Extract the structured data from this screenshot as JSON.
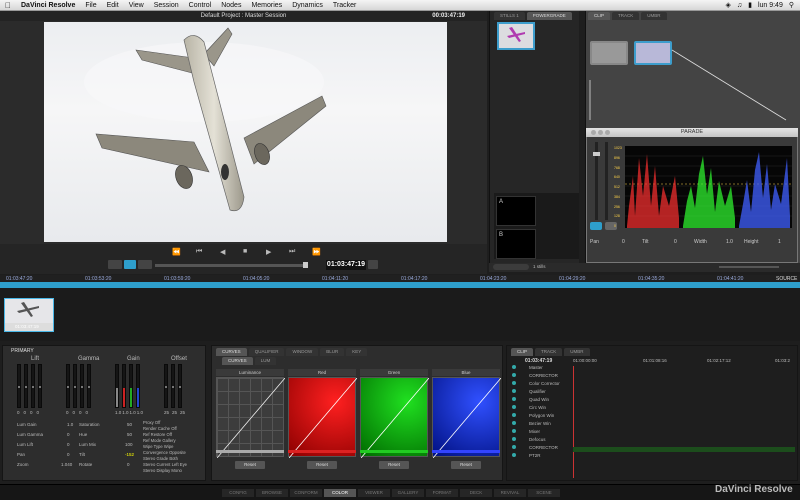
{
  "menubar": {
    "app": "DaVinci Resolve",
    "items": [
      "File",
      "Edit",
      "View",
      "Session",
      "Control",
      "Nodes",
      "Memories",
      "Dynamics",
      "Tracker"
    ],
    "clock": "lun 9:49"
  },
  "viewer": {
    "title": "Default Project : Master Session",
    "timecode_top": "00:03:47:19",
    "timecode": "01:03:47:19"
  },
  "gallery": {
    "tabs": [
      "STILLS 1",
      "POWERGRADE"
    ],
    "labels": [
      "A",
      "B"
    ],
    "status": "1 stills"
  },
  "nodes_panel": {
    "tabs": [
      "CLIP",
      "TRACK",
      "UMBR"
    ]
  },
  "parade": {
    "title": "PARADE",
    "scale": [
      "1023",
      "896",
      "768",
      "640",
      "512",
      "384",
      "256",
      "128",
      "0"
    ],
    "params": [
      {
        "label": "Pan",
        "value": "0"
      },
      {
        "label": "Tilt",
        "value": "0"
      },
      {
        "label": "Width",
        "value": "1.0"
      },
      {
        "label": "Height",
        "value": "1"
      }
    ]
  },
  "timeline": {
    "ruler": [
      "01:03:47:20",
      "01:03:53:20",
      "01:03:59:20",
      "01:04:05:20",
      "01:04:11:20",
      "01:04:17:20",
      "01:04:23:20",
      "01:04:29:20",
      "01:04:35:20",
      "01:04:41:20"
    ],
    "source_label": "SOURCE",
    "clip_label": "01:03:47:19"
  },
  "primary": {
    "title": "PRIMARY",
    "groups": [
      "Lift",
      "Gamma",
      "Gain",
      "Offset"
    ],
    "lift_vals": [
      "0",
      "0",
      "0",
      "0"
    ],
    "gamma_vals": [
      "0",
      "0",
      "0",
      "0"
    ],
    "gain_vals": [
      "1.0",
      "1.0",
      "1.0",
      "1.0"
    ],
    "offset_vals": [
      "25",
      "25",
      "25"
    ],
    "rows_left": [
      {
        "label": "Lum Gain",
        "value": "1.0"
      },
      {
        "label": "Lum Gamma",
        "value": "0"
      },
      {
        "label": "Lum Lift",
        "value": "0"
      },
      {
        "label": "Pan",
        "value": "0"
      },
      {
        "label": "Zoom",
        "value": "1.040"
      }
    ],
    "rows_mid": [
      {
        "label": "Saturation",
        "value": "50"
      },
      {
        "label": "Hue",
        "value": "50"
      },
      {
        "label": "Lum Mix",
        "value": "100"
      },
      {
        "label": "Tilt",
        "value": "-152"
      },
      {
        "label": "Rotate",
        "value": "0"
      }
    ],
    "rows_right": [
      {
        "label": "Proxy",
        "value": "Off"
      },
      {
        "label": "Render Cache",
        "value": "Off"
      },
      {
        "label": "Ref Restore",
        "value": "Off"
      },
      {
        "label": "Ref Mode",
        "value": "Gallery"
      },
      {
        "label": "Wipe Type",
        "value": "Wipe"
      },
      {
        "label": "Convergence",
        "value": "Opposite"
      },
      {
        "label": "Stereo Grade",
        "value": "Both"
      },
      {
        "label": "Stereo Current",
        "value": "Left Eye"
      },
      {
        "label": "Stereo Display",
        "value": "Mono"
      }
    ]
  },
  "curves": {
    "tabs": [
      "CURVES",
      "QUALIFIER",
      "WINDOW",
      "BLUR",
      "KEY"
    ],
    "subtabs": [
      "CURVES",
      "LUM"
    ],
    "channels": [
      "Luminance",
      "Red",
      "Green",
      "Blue"
    ],
    "reset": "Reset"
  },
  "cliplist": {
    "tabs": [
      "CLIP",
      "TRACK",
      "UMBR"
    ],
    "timecodes": [
      "01:03:47:19",
      "01:00:00:00",
      "01:01:08:16",
      "01:02:17:12",
      "01:03:2"
    ],
    "rows": [
      "Master",
      "CORRECTOR",
      "Color Corrector",
      "Qualifier",
      "Quad Win",
      "Circ Win",
      "Polygon Win",
      "Bezier Win",
      "Mixer",
      "Defocus",
      "CORRECTOR",
      "PT2R"
    ]
  },
  "pages": [
    "CONFIG",
    "BROWSE",
    "CONFORM",
    "COLOR",
    "VIEWER",
    "GALLERY",
    "FORMAT",
    "DECK",
    "REVIVAL",
    "SCENE"
  ],
  "active_page": "COLOR",
  "brand": "DaVinci Resolve",
  "colors": {
    "accent": "#2e9fcc",
    "scope_red": "#ff3030",
    "scope_green": "#30ff30",
    "scope_blue": "#4060ff"
  }
}
